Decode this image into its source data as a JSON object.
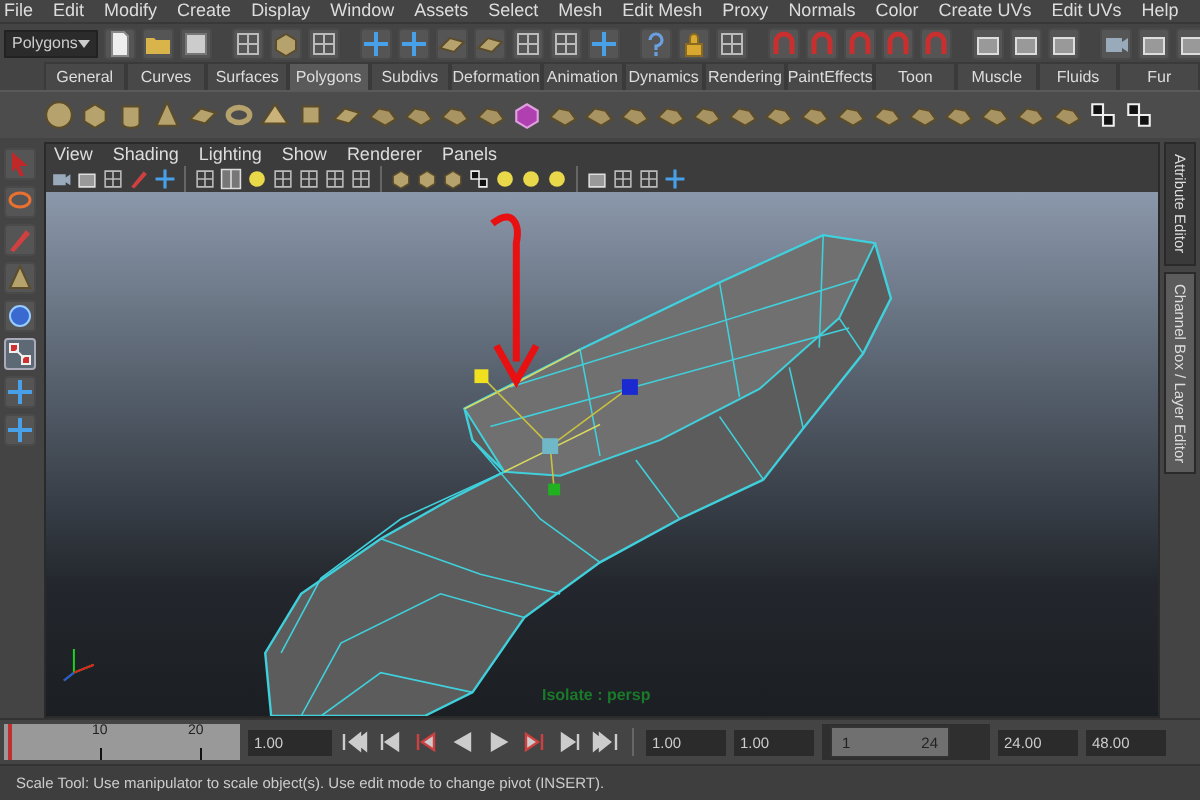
{
  "menu_bar": [
    "File",
    "Edit",
    "Modify",
    "Create",
    "Display",
    "Window",
    "Assets",
    "Select",
    "Mesh",
    "Edit Mesh",
    "Proxy",
    "Normals",
    "Color",
    "Create UVs",
    "Edit UVs",
    "Help"
  ],
  "toolbar": {
    "menu_set": "Polygons"
  },
  "shelf": {
    "tabs": [
      {
        "label": "General",
        "selected": false
      },
      {
        "label": "Curves",
        "selected": false
      },
      {
        "label": "Surfaces",
        "selected": false
      },
      {
        "label": "Polygons",
        "selected": true
      },
      {
        "label": "Subdivs",
        "selected": false
      },
      {
        "label": "Deformation",
        "selected": false
      },
      {
        "label": "Animation",
        "selected": false
      },
      {
        "label": "Dynamics",
        "selected": false
      },
      {
        "label": "Rendering",
        "selected": false
      },
      {
        "label": "PaintEffects",
        "selected": false
      },
      {
        "label": "Toon",
        "selected": false
      },
      {
        "label": "Muscle",
        "selected": false
      },
      {
        "label": "Fluids",
        "selected": false
      },
      {
        "label": "Fur",
        "selected": false
      }
    ]
  },
  "toolbox": {
    "tools": [
      {
        "selected": false
      },
      {
        "selected": false
      },
      {
        "selected": false
      },
      {
        "selected": false
      },
      {
        "selected": false
      },
      {
        "selected": true
      },
      {
        "selected": false
      },
      {
        "selected": false
      }
    ]
  },
  "viewport": {
    "menu": [
      "View",
      "Shading",
      "Lighting",
      "Show",
      "Renderer",
      "Panels"
    ],
    "isolate_label": "Isolate : persp"
  },
  "side_tabs": [
    {
      "label": "Attribute Editor",
      "selected": false
    },
    {
      "label": "Channel Box / Layer Editor",
      "selected": true
    }
  ],
  "time_slider": {
    "ticks": [
      "10",
      "20"
    ],
    "current_time": "1.00",
    "level": 0.02
  },
  "range_slider": {
    "level": 0.75,
    "start_time": "1.00",
    "playback_start": "1.00",
    "range_start": "1",
    "range_end": "24",
    "playback_end": "24.00",
    "end_time": "48.00"
  },
  "status_line": "Scale Tool: Use manipulator to scale object(s). Use edit mode to change pivot (INSERT)."
}
